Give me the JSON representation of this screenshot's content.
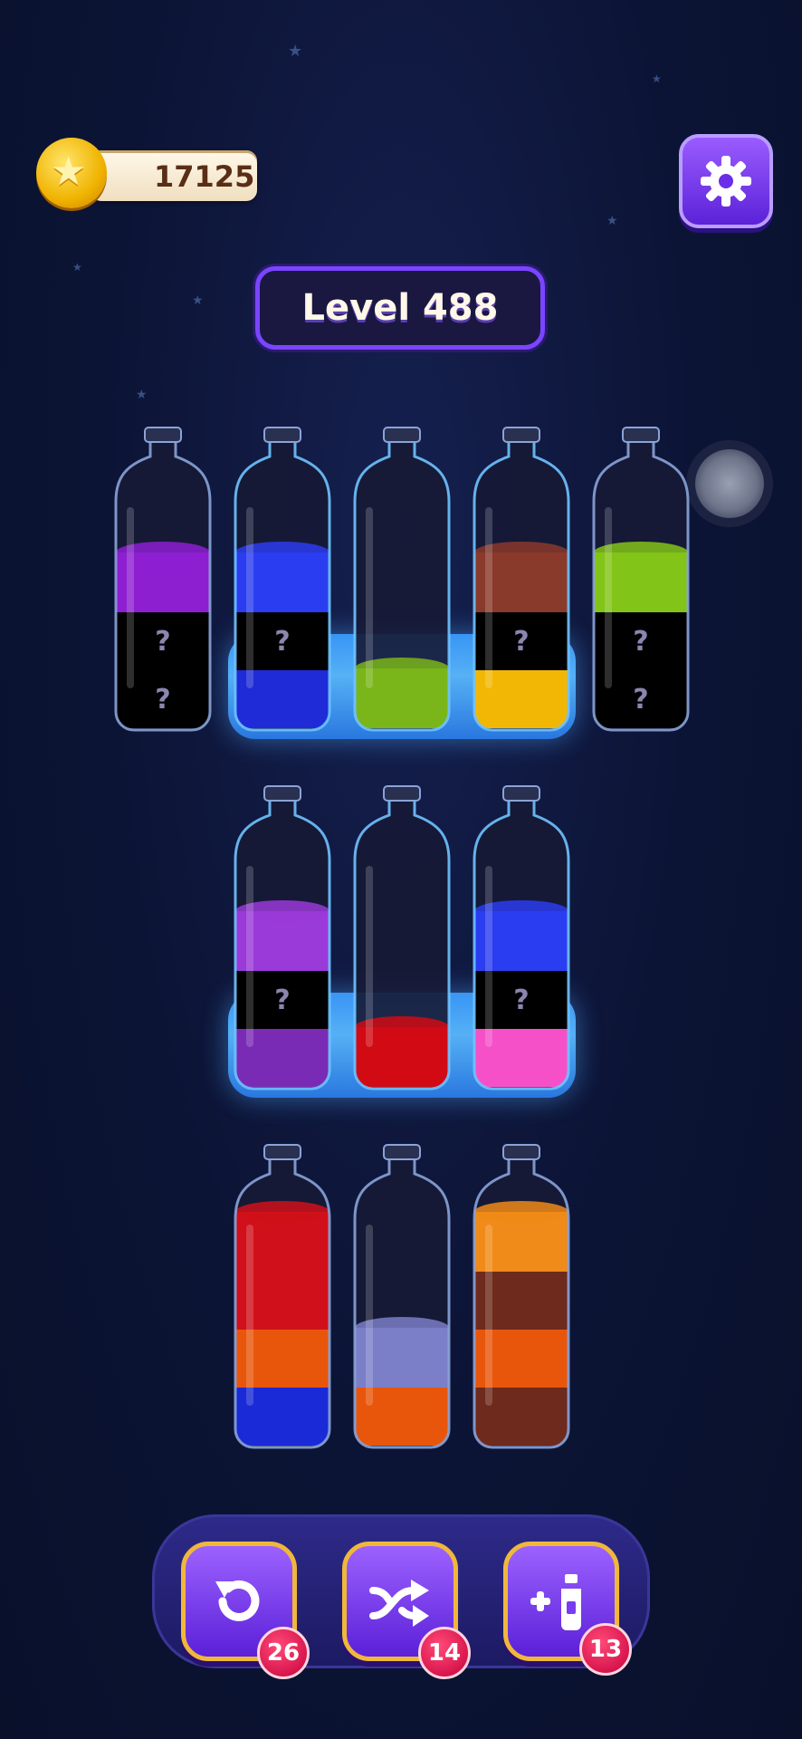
{
  "coins": {
    "value": "17125"
  },
  "level": {
    "label": "Level 488"
  },
  "hidden_mark": "?",
  "bottles": [
    {
      "id": "r1c1",
      "frozen": false,
      "layers": [
        "#000000",
        "#000000",
        "#8d1fd1"
      ],
      "hidden": [
        true,
        true,
        false
      ]
    },
    {
      "id": "r1c2",
      "frozen": true,
      "layers": [
        "#1e2bd6",
        "#000000",
        "#2b3df0"
      ],
      "hidden": [
        false,
        true,
        false
      ]
    },
    {
      "id": "r1c3",
      "frozen": true,
      "layers": [
        "#7ab51a"
      ],
      "hidden": [
        false
      ]
    },
    {
      "id": "r1c4",
      "frozen": true,
      "layers": [
        "#f2b705",
        "#000000",
        "#8a3a2a"
      ],
      "hidden": [
        false,
        true,
        false
      ]
    },
    {
      "id": "r1c5",
      "frozen": false,
      "layers": [
        "#000000",
        "#000000",
        "#82c418"
      ],
      "hidden": [
        true,
        true,
        false
      ]
    },
    {
      "id": "r2c1",
      "frozen": true,
      "layers": [
        "#7a2bb5",
        "#000000",
        "#9a3ad8"
      ],
      "hidden": [
        false,
        true,
        false
      ]
    },
    {
      "id": "r2c2",
      "frozen": true,
      "layers": [
        "#d10a14"
      ],
      "hidden": [
        false
      ]
    },
    {
      "id": "r2c3",
      "frozen": true,
      "layers": [
        "#f550c8",
        "#000000",
        "#2b3df0"
      ],
      "hidden": [
        false,
        true,
        false
      ]
    },
    {
      "id": "r3c1",
      "frozen": false,
      "layers": [
        "#1a2ad6",
        "#e8560c",
        "#d0101a",
        "#d0101a"
      ],
      "hidden": [
        false,
        false,
        false,
        false
      ]
    },
    {
      "id": "r3c2",
      "frozen": false,
      "layers": [
        "#e8560c",
        "#7a7fc8"
      ],
      "hidden": [
        false,
        false
      ]
    },
    {
      "id": "r3c3",
      "frozen": false,
      "layers": [
        "#6e2a1c",
        "#e8560c",
        "#6e2a1c",
        "#f08a18"
      ],
      "hidden": [
        false,
        false,
        false,
        false
      ]
    }
  ],
  "tools": [
    {
      "name": "undo",
      "icon": "undo-icon",
      "count": "26"
    },
    {
      "name": "shuffle",
      "icon": "shuffle-icon",
      "count": "14"
    },
    {
      "name": "add-bottle",
      "icon": "add-bottle-icon",
      "count": "13"
    }
  ],
  "colors": {
    "accent": "#7a45ff",
    "gold": "#f0b83a",
    "badge": "#d4004a",
    "ice": "#4aa8ff"
  }
}
